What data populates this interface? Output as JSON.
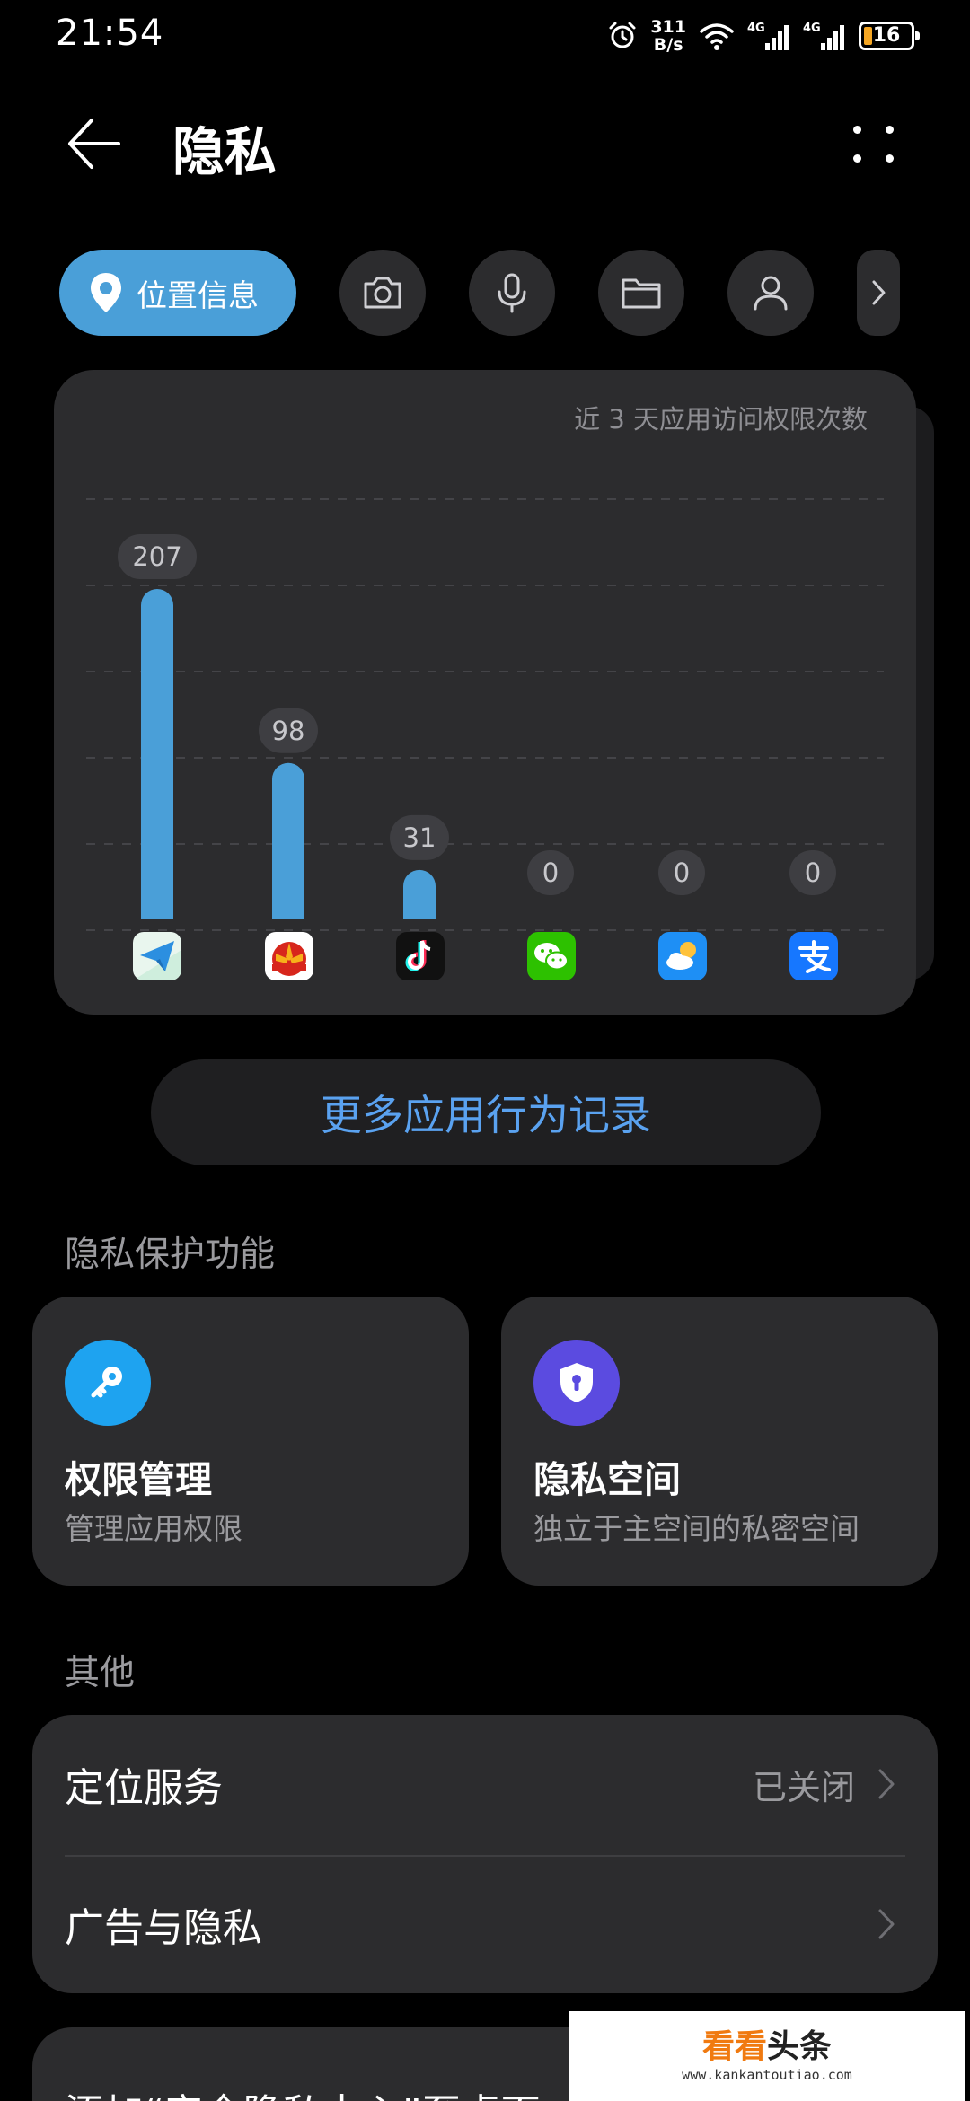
{
  "status_bar": {
    "time": "21:54",
    "net_speed_value": "311",
    "net_speed_unit": "B/s",
    "network_1": "4G",
    "network_2": "4G",
    "battery": "16",
    "battery_color": "#f5a623"
  },
  "header": {
    "title": "隐私",
    "back_icon": "arrow-left-icon",
    "more_icon": "more-dots-icon"
  },
  "categories": {
    "active_label": "位置信息",
    "active_icon": "location-pin-icon",
    "active_color": "#4a9fd8",
    "others": [
      "camera-icon",
      "microphone-icon",
      "folder-icon",
      "contacts-icon"
    ],
    "more_icon": "chevron-right-icon"
  },
  "chart_data": {
    "type": "bar",
    "title": "近 3 天应用访问权限次数",
    "categories": [
      "telegram-app-icon",
      "petrochina-app-icon",
      "douyin-app-icon",
      "wechat-app-icon",
      "weather-app-icon",
      "alipay-app-icon"
    ],
    "values": [
      207,
      98,
      31,
      0,
      0,
      0
    ],
    "ylim": [
      0,
      270
    ],
    "grid": true,
    "bar_color": "#4a9fd8"
  },
  "more_records_label": "更多应用行为记录",
  "sections": {
    "privacy_protection": "隐私保护功能",
    "other": "其他"
  },
  "features": [
    {
      "title": "权限管理",
      "subtitle": "管理应用权限",
      "icon": "key-icon",
      "color": "#1ea3f0"
    },
    {
      "title": "隐私空间",
      "subtitle": "独立于主空间的私密空间",
      "icon": "shield-lock-icon",
      "color": "#5b4be0"
    }
  ],
  "other_items": [
    {
      "label": "定位服务",
      "value": "已关闭"
    },
    {
      "label": "广告与隐私",
      "value": ""
    }
  ],
  "add_to_desktop": "添加“安全隐私中心”至桌面",
  "watermark": {
    "part_a": "看看",
    "part_b": "头条",
    "url": "www.kankantoutiao.com"
  }
}
